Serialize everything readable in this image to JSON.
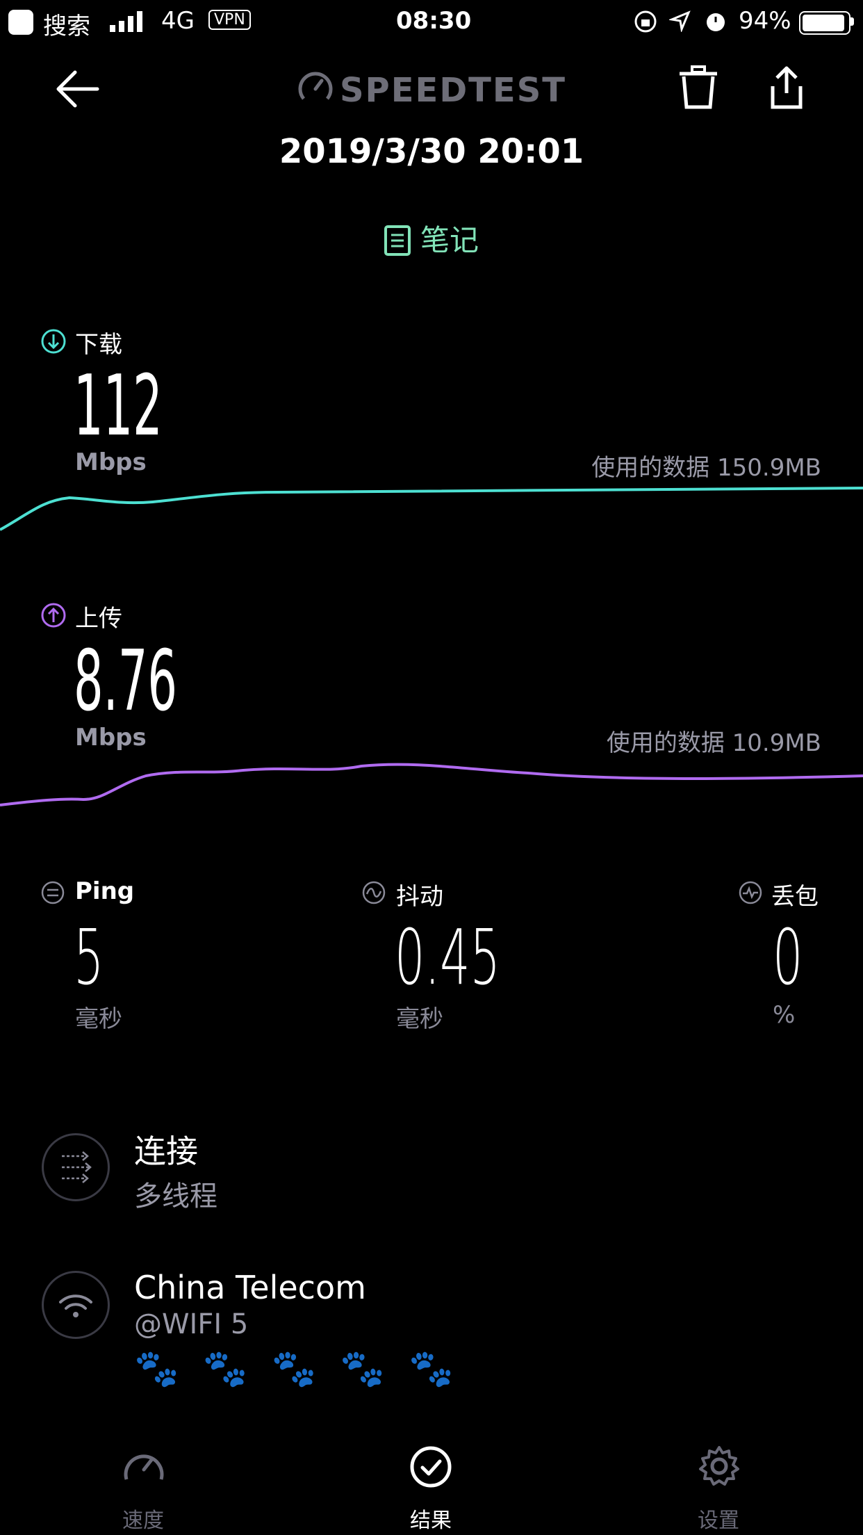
{
  "status_bar": {
    "back_app": "搜索",
    "network": "4G",
    "vpn": "VPN",
    "time": "08:30",
    "battery": "94%"
  },
  "header": {
    "brand": "SPEEDTEST",
    "datetime": "2019/3/30 20:01",
    "notes_label": "笔记"
  },
  "download": {
    "label": "下载",
    "value": "112",
    "unit": "Mbps",
    "data_used": "使用的数据 150.9MB",
    "color": "#4de0d2"
  },
  "upload": {
    "label": "上传",
    "value": "8.76",
    "unit": "Mbps",
    "data_used": "使用的数据 10.9MB",
    "color": "#b06bf0"
  },
  "stats": {
    "ping": {
      "label": "Ping",
      "value": "5",
      "unit": "毫秒"
    },
    "jitter": {
      "label": "抖动",
      "value": "0.45",
      "unit": "毫秒"
    },
    "loss": {
      "label": "丢包",
      "value": "0",
      "unit": "%"
    }
  },
  "connection": {
    "title": "连接",
    "subtitle": "多线程"
  },
  "provider": {
    "name": "China Telecom",
    "network": "@WIFI  5",
    "paws": [
      "🐾",
      "🐾",
      "🐾",
      "🐾",
      "🐾"
    ]
  },
  "tabs": [
    {
      "label": "速度",
      "icon": "speedometer-icon"
    },
    {
      "label": "结果",
      "icon": "check-circle-icon"
    },
    {
      "label": "设置",
      "icon": "gear-icon"
    }
  ]
}
